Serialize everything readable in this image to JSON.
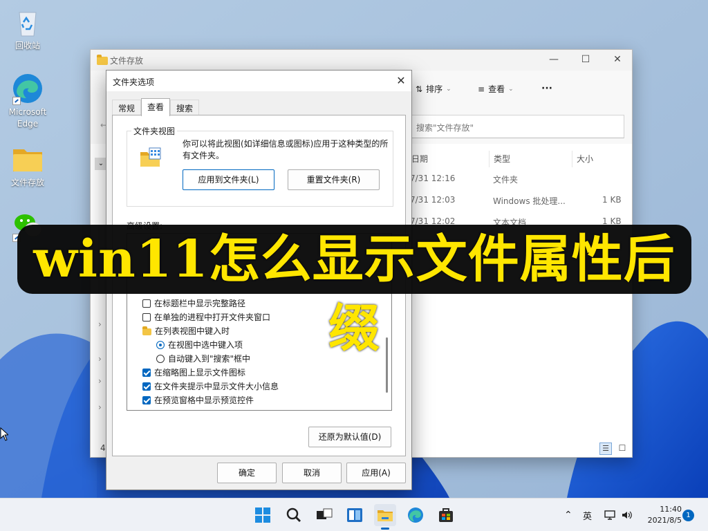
{
  "desktop": {
    "icons": [
      {
        "label": "回收站",
        "icon": "recycle-bin-icon"
      },
      {
        "label": "Microsoft Edge",
        "icon": "edge-icon"
      },
      {
        "label": "文件存放",
        "icon": "folder-icon"
      },
      {
        "label": "",
        "icon": "wechat-icon"
      }
    ]
  },
  "explorer": {
    "title": "文件存放",
    "toolbar": {
      "sort_label": "排序",
      "view_label": "查看",
      "more_label": "···"
    },
    "search_placeholder": "搜索\"文件存放\"",
    "columns": [
      "日期",
      "类型",
      "大小"
    ],
    "rows": [
      {
        "date": "7/31 12:16",
        "type": "文件夹",
        "size": ""
      },
      {
        "date": "7/31 12:03",
        "type": "Windows 批处理...",
        "size": "1 KB"
      },
      {
        "date": "7/31 12:02",
        "type": "文本文档",
        "size": "1 KB"
      }
    ],
    "status_count": "4"
  },
  "dialog": {
    "title": "文件夹选项",
    "tabs": [
      "常规",
      "查看",
      "搜索"
    ],
    "active_tab": "查看",
    "folder_view": {
      "label": "文件夹视图",
      "description": "你可以将此视图(如详细信息或图标)应用于这种类型的所有文件夹。",
      "apply_button": "应用到文件夹(L)",
      "reset_button": "重置文件夹(R)"
    },
    "advanced_label": "高级设置:",
    "settings": [
      {
        "kind": "checkbox",
        "label": "在标题栏中显示完整路径",
        "checked": false,
        "indent": 0
      },
      {
        "kind": "checkbox",
        "label": "在单独的进程中打开文件夹窗口",
        "checked": false,
        "indent": 0
      },
      {
        "kind": "folder",
        "label": "在列表视图中键入时",
        "indent": 0
      },
      {
        "kind": "radio",
        "label": "在视图中选中键入项",
        "checked": true,
        "indent": 1
      },
      {
        "kind": "radio",
        "label": "自动键入到\"搜索\"框中",
        "checked": false,
        "indent": 1
      },
      {
        "kind": "checkbox",
        "label": "在缩略图上显示文件图标",
        "checked": true,
        "indent": 0
      },
      {
        "kind": "checkbox",
        "label": "在文件夹提示中显示文件大小信息",
        "checked": true,
        "indent": 0
      },
      {
        "kind": "checkbox",
        "label": "在预览窗格中显示预览控件",
        "checked": true,
        "indent": 0
      }
    ],
    "restore_button": "还原为默认值(D)",
    "ok_button": "确定",
    "cancel_button": "取消",
    "apply_button": "应用(A)"
  },
  "caption": "win11怎么显示文件属性后缀",
  "taskbar": {
    "apps": [
      "start-icon",
      "search-icon",
      "task-view-icon",
      "widgets-icon",
      "file-explorer-icon",
      "edge-icon",
      "store-icon"
    ],
    "ime": "英",
    "time": "11:40",
    "date": "2021/8/5",
    "notification_count": "1"
  },
  "colors": {
    "accent": "#0067c0",
    "caption_text": "#ffe600",
    "caption_bg": "#080808"
  }
}
